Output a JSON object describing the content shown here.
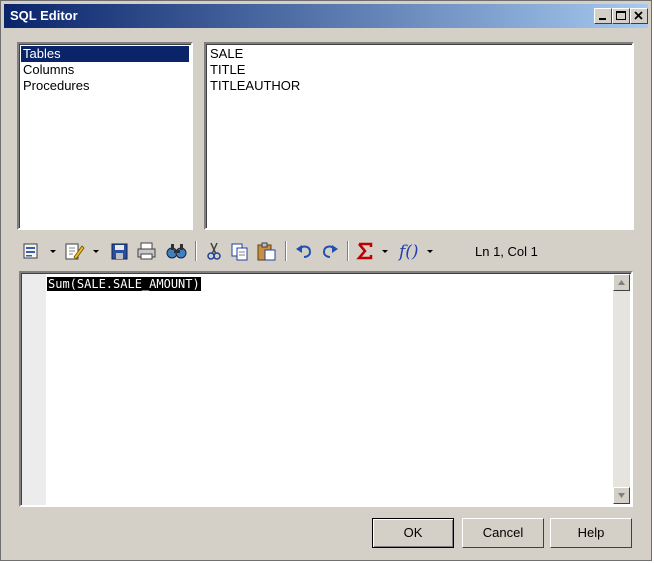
{
  "window": {
    "title": "SQL Editor"
  },
  "title_buttons": {
    "minimize": "minimize-icon",
    "maximize": "maximize-icon",
    "close": "close-icon"
  },
  "object_types": [
    {
      "label": "Tables",
      "selected": true
    },
    {
      "label": "Columns",
      "selected": false
    },
    {
      "label": "Procedures",
      "selected": false
    }
  ],
  "objects": [
    "SALE",
    "TITLE",
    "TITLEAUTHOR"
  ],
  "toolbar": {
    "icons": [
      "edit-menu-icon",
      "edit-pencil-icon",
      "save-icon",
      "print-icon",
      "find-icon",
      "cut-icon",
      "copy-icon",
      "paste-icon",
      "undo-icon",
      "redo-icon",
      "sigma-icon",
      "function-icon"
    ],
    "cursor_position": "Ln 1, Col 1"
  },
  "editor": {
    "text": "Sum(SALE.SALE_AMOUNT)"
  },
  "buttons": {
    "ok": "OK",
    "cancel": "Cancel",
    "help": "Help"
  },
  "colors": {
    "selection": "#0a246a",
    "face": "#d4d0c8",
    "titlebar_start": "#0a246a",
    "titlebar_end": "#a6caf0"
  }
}
